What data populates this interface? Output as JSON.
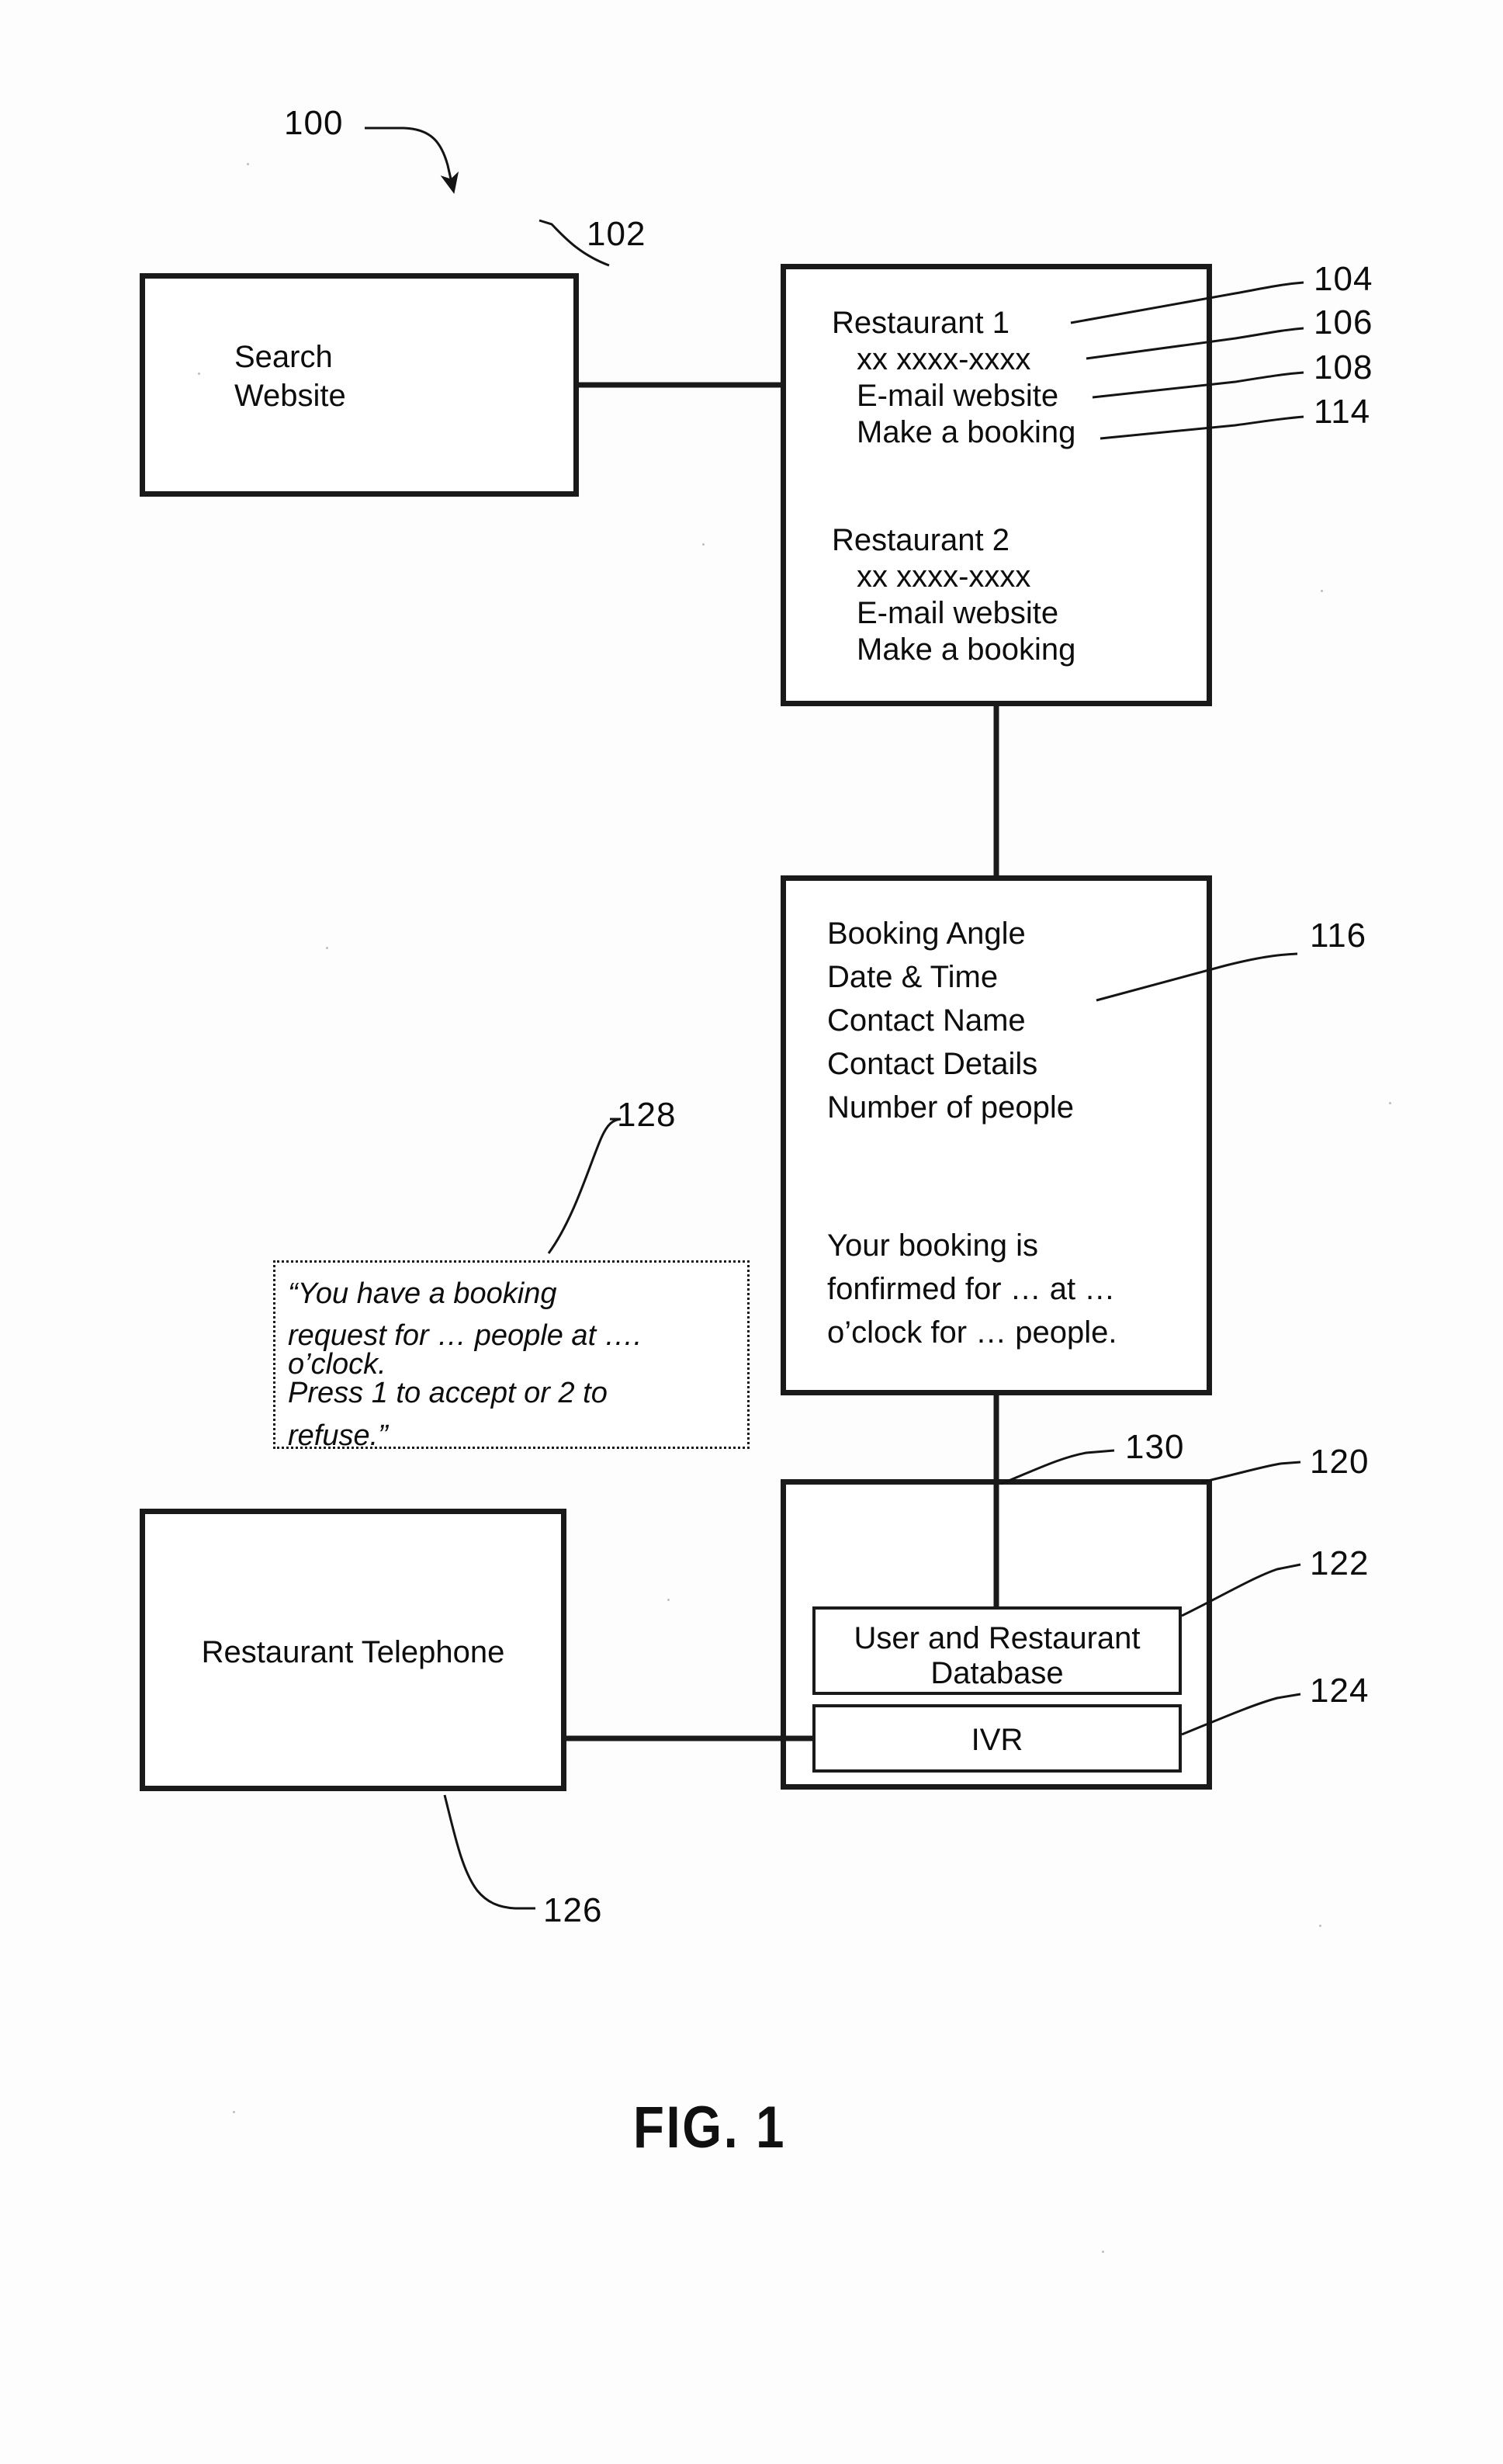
{
  "figure": {
    "caption": "FIG. 1",
    "system_ref": "100"
  },
  "refs": {
    "system": "100",
    "search_website": "102",
    "restaurant_name": "104",
    "restaurant_phone": "106",
    "restaurant_email": "108",
    "make_booking": "114",
    "booking_details": "116",
    "server": "120",
    "database": "122",
    "ivr": "124",
    "restaurant_telephone": "126",
    "ivr_script": "128",
    "link_130": "130"
  },
  "search_box": {
    "line1": "Search",
    "line2": "Website"
  },
  "results_box": {
    "restaurants": [
      {
        "name": "Restaurant 1",
        "phone": "xx xxxx-xxxx",
        "email": "E-mail website",
        "booking": "Make a booking"
      },
      {
        "name": "Restaurant 2",
        "phone": "xx xxxx-xxxx",
        "email": "E-mail website",
        "booking": "Make a booking"
      }
    ]
  },
  "booking_box": {
    "fields": [
      "Booking Angle",
      "Date & Time",
      "Contact Name",
      "Contact Details",
      "Number of people"
    ],
    "confirmation": [
      "Your booking is",
      "fonfirmed for … at …",
      "o’clock for … people."
    ]
  },
  "ivr_script_box": {
    "lines": [
      "“You have a booking",
      "request for … people at ….",
      "o’clock.",
      "Press 1 to accept or 2 to",
      "refuse.”"
    ]
  },
  "server_box": {
    "database_line1": "User and Restaurant",
    "database_line2": "Database",
    "ivr_label": "IVR"
  },
  "telephone_box": {
    "label": "Restaurant Telephone"
  },
  "colors": {
    "ink": "#1a1a1a",
    "paper": "#ffffff"
  }
}
